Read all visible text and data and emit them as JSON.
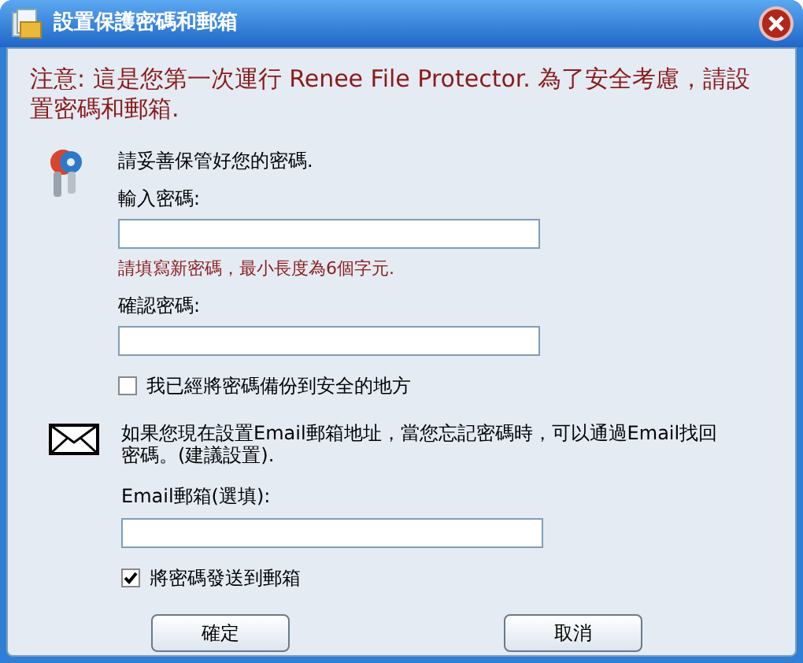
{
  "window": {
    "title": "設置保護密碼和郵箱"
  },
  "notice": "注意: 這是您第一次運行 Renee File Protector. 為了安全考慮，請設置密碼和郵箱.",
  "password_section": {
    "intro": "請妥善保管好您的密碼.",
    "password_label": "輸入密碼:",
    "hint": "請填寫新密碼，最小長度為6個字元.",
    "confirm_label": "確認密碼:",
    "backup_checkbox": {
      "label": "我已經將密碼備份到安全的地方",
      "checked": false
    }
  },
  "email_section": {
    "intro": "如果您現在設置Email郵箱地址，當您忘記密碼時，可以通過Email找回密碼。(建議設置).",
    "email_label": "Email郵箱(選填):",
    "send_checkbox": {
      "label": "將密碼發送到郵箱",
      "checked": true
    }
  },
  "buttons": [
    "確定",
    "取消"
  ]
}
